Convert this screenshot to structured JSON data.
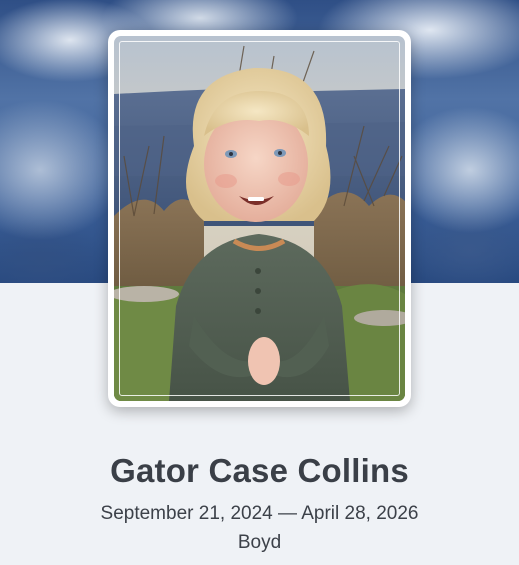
{
  "profile": {
    "name": "Gator Case Collins",
    "date_range": "September 21, 2024 — April 28, 2026",
    "location": "Boyd"
  },
  "cover_image": "cloudy-sky-banner",
  "portrait_image": "smiling-toddler-outdoors",
  "colors": {
    "page_background": "#eff2f6",
    "text_primary": "#3a3f47",
    "card_border": "#ffffff",
    "sky_blue": "#3b5f98"
  }
}
